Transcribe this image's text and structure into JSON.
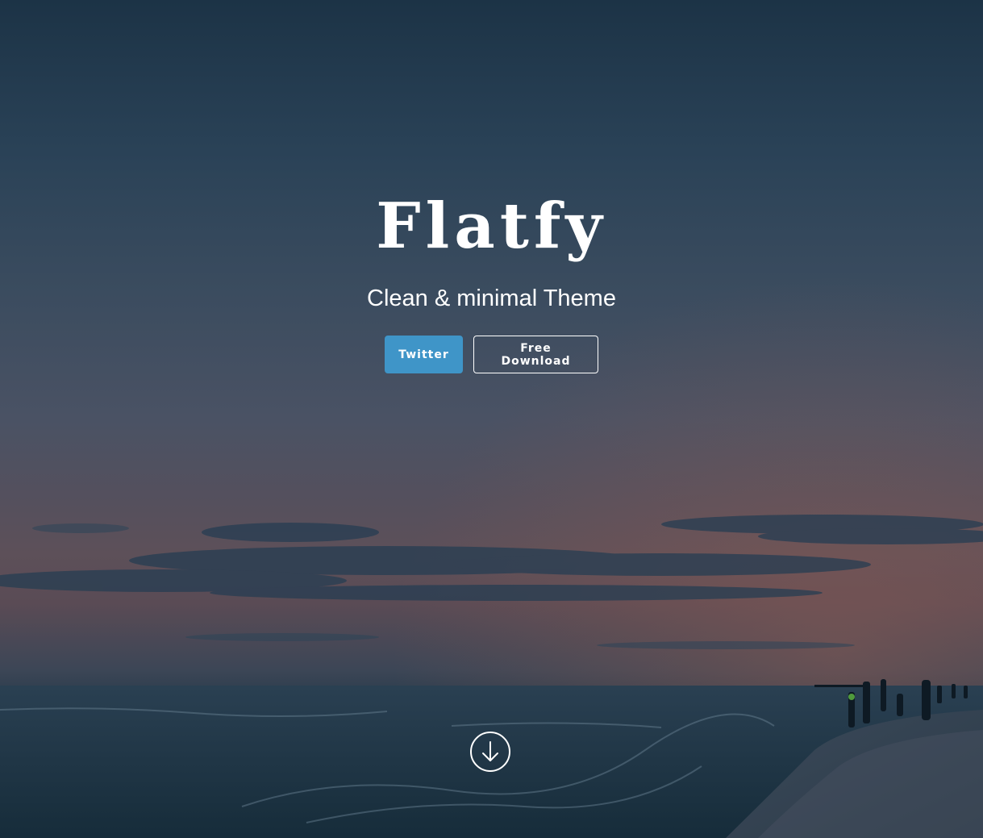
{
  "hero": {
    "title": "Flatfy",
    "subtitle": "Clean & minimal Theme",
    "background_icon": "beach-sunset-photo"
  },
  "buttons": {
    "twitter_label": "Twitter",
    "download_label": "Free Download"
  },
  "scroll": {
    "icon": "arrow-down-circle-icon"
  },
  "colors": {
    "accent": "#3f95c8",
    "text": "#ffffff",
    "sky_top": "#1c3346",
    "sky_horizon": "#5d5059",
    "sea": "#1a3040"
  }
}
